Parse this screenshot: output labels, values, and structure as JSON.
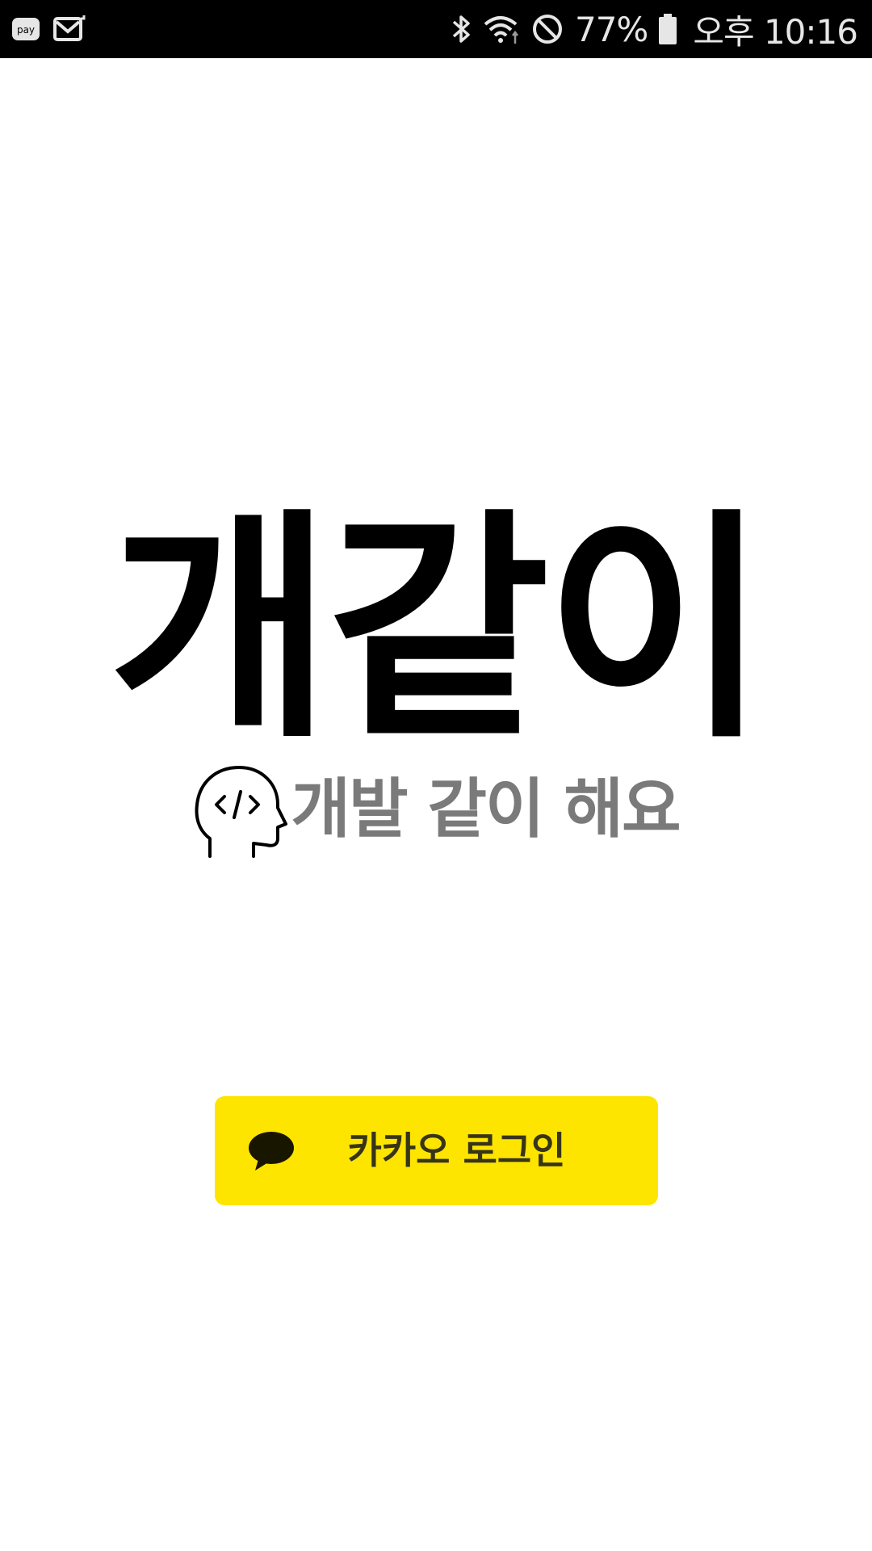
{
  "status_bar": {
    "left_icons": [
      "samsung-pay-icon",
      "mail-icon"
    ],
    "right_icons": [
      "bluetooth-icon",
      "wifi-icon",
      "do-not-disturb-icon",
      "battery-icon"
    ],
    "pay_label": "pay",
    "battery_percent": "77%",
    "time": "오후 10:16"
  },
  "branding": {
    "app_title": "개같이",
    "tagline": "개발 같이 해요",
    "tagline_icon": "developer-head-icon",
    "tagline_color": "#7a7a7a"
  },
  "login": {
    "kakao_button_label": "카카오 로그인",
    "kakao_icon": "kakao-speech-bubble-icon",
    "kakao_color": "#FEE500"
  }
}
